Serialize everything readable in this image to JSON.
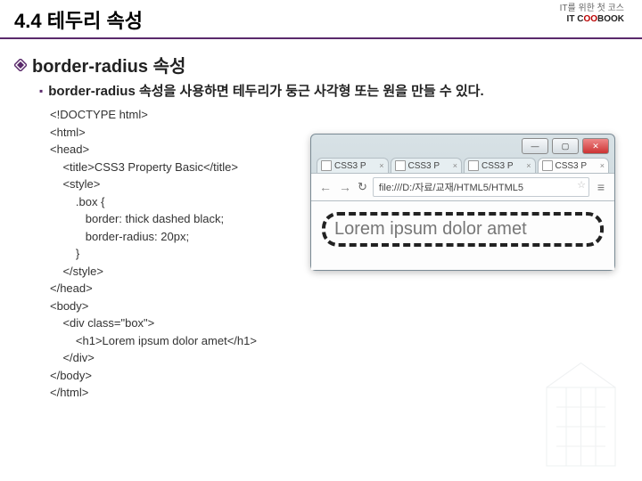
{
  "heading": "4.4 테두리 속성",
  "logo": {
    "tag": "IT C",
    "tag2": "BOOK",
    "sub": "IT를 위한 첫 코스"
  },
  "block": {
    "title": "border-radius 속성",
    "sub": "border-radius 속성을 사용하면 테두리가 둥근 사각형 또는 원을 만들 수 있다."
  },
  "code": {
    "l1": "<!DOCTYPE html>",
    "l2": "<html>",
    "l3": "<head>",
    "l4": "    <title>CSS3 Property Basic</title>",
    "l5": "    <style>",
    "l6": "        .box {",
    "l7": "           border: thick dashed black;",
    "l8": "           border-radius: 20px;",
    "l9": "        }",
    "l10": "    </style>",
    "l11": "</head>",
    "l12": "<body>",
    "l13": "    <div class=\"box\">",
    "l14": "        <h1>Lorem ipsum dolor amet</h1>",
    "l15": "    </div>",
    "l16": "</body>",
    "l17": "</html>"
  },
  "browser": {
    "tabs": {
      "t1": "CSS3 P",
      "t2": "CSS3 P",
      "t3": "CSS3 P",
      "t4": "CSS3 P"
    },
    "url": "file:///D:/자료/교재/HTML5/HTML5",
    "rendered": "Lorem ipsum dolor amet",
    "winbtn": {
      "min": "—",
      "max": "▢",
      "close": "✕"
    }
  }
}
